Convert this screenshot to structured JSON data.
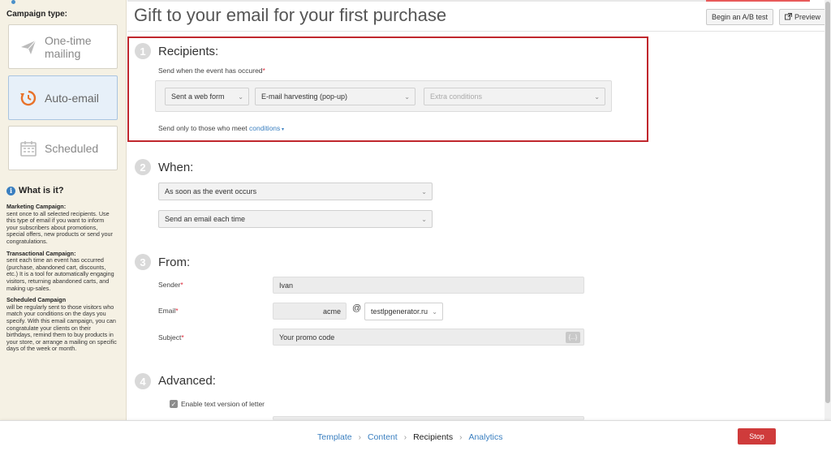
{
  "sidebar": {
    "title": "Campaign type:",
    "types": [
      {
        "label": "One-time mailing",
        "icon": "paper-plane-icon"
      },
      {
        "label": "Auto-email",
        "icon": "auto-refresh-icon"
      },
      {
        "label": "Scheduled",
        "icon": "calendar-icon"
      }
    ],
    "what_title": "What is it?",
    "descriptions": [
      {
        "title": "Marketing Campaign:",
        "text": "sent once to all selected recipients. Use this type of email if you want to inform your subscribers about promotions, special offers, new products or send your congratulations."
      },
      {
        "title": "Transactional Campaign:",
        "text": "sent each time an event has occurred (purchase, abandoned cart, discounts, etc.) It is a tool for automatically engaging visitors, returning abandoned carts, and making up-sales."
      },
      {
        "title": "Scheduled Campaign",
        "text": "will be regularly sent to those visitors who match your conditions on the days you specify. With this email campaign, you can congratulate your clients on their birthdays, remind them to buy products in your store, or arrange a mailing on specific days of the week or month."
      }
    ]
  },
  "header": {
    "title": "Gift to your email for your first purchase",
    "ab_test": "Begin an A/B test",
    "preview": "Preview"
  },
  "recipients": {
    "num": "1",
    "title": "Recipients:",
    "event_label": "Send when the event has occured",
    "event_select": "Sent a web form",
    "form_select": "E-mail harvesting (pop-up)",
    "extra_select": "Extra conditions",
    "meet_text": "Send only to those who meet",
    "conditions_link": "conditions"
  },
  "when": {
    "num": "2",
    "title": "When:",
    "timing": "As soon as the event occurs",
    "frequency": "Send an email each time"
  },
  "from": {
    "num": "3",
    "title": "From:",
    "sender_label": "Sender",
    "sender_value": "Ivan",
    "email_label": "Email",
    "email_local": "acme",
    "at": "@",
    "email_domain": "testlpgenerator.ru",
    "subject_label": "Subject",
    "subject_value": "Your promo code",
    "vars_label": "{...}"
  },
  "advanced": {
    "num": "4",
    "title": "Advanced:",
    "text_version": "Enable text version of letter"
  },
  "footer": {
    "steps": [
      "Template",
      "Content",
      "Recipients",
      "Analytics"
    ],
    "current_step": "Recipients",
    "stop": "Stop"
  },
  "colors": {
    "accent": "#3a7fc0",
    "danger": "#cf3b3b",
    "highlight_border": "#c0272d",
    "sidebar_bg": "#f5f1e4"
  }
}
